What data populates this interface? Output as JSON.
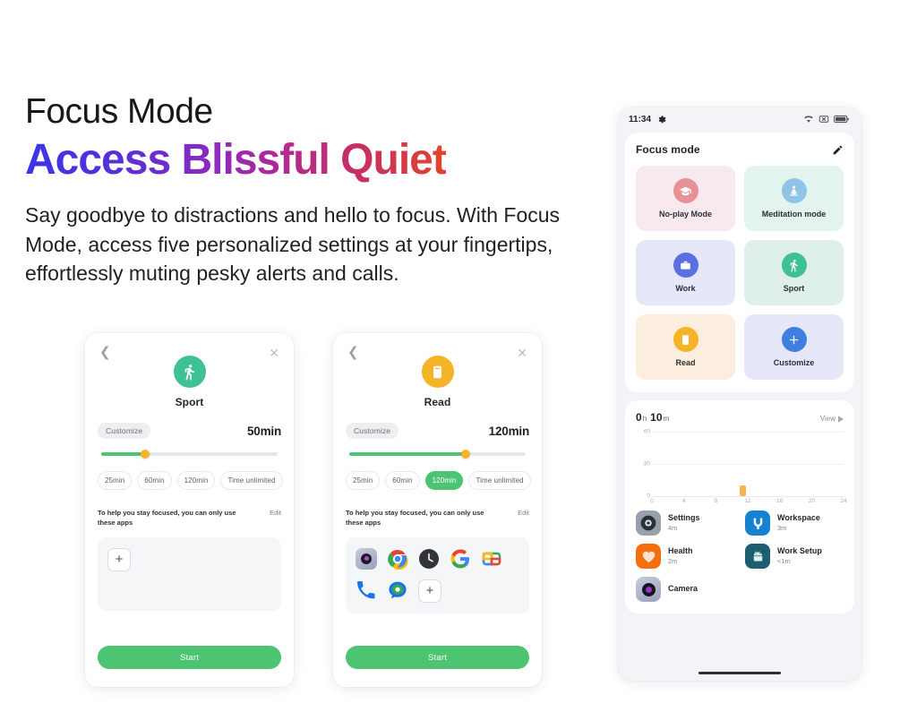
{
  "marketing": {
    "eyebrow": "Focus Mode",
    "headline": "Access Blissful Quiet",
    "body": "Say goodbye to distractions and hello to focus. With Focus Mode, access five personalized settings at your fingertips, effortlessly muting pesky alerts and calls."
  },
  "mock_sport": {
    "back_icon": "chevron-left-icon",
    "close_icon": "close-icon",
    "mode_name": "Sport",
    "mode_icon": "running-icon",
    "mode_color": "#3fc293",
    "customize_label": "Customize",
    "duration_value": "50min",
    "slider_percent": 25,
    "pills": [
      {
        "label": "25min",
        "selected": false
      },
      {
        "label": "60min",
        "selected": false
      },
      {
        "label": "120min",
        "selected": false
      },
      {
        "label": "Time unlimited",
        "selected": false
      }
    ],
    "note": "To help you stay focused, you can only use these apps",
    "edit_label": "Edit",
    "apps": [],
    "add_label": "+",
    "start_label": "Start"
  },
  "mock_read": {
    "back_icon": "chevron-left-icon",
    "close_icon": "close-icon",
    "mode_name": "Read",
    "mode_icon": "book-icon",
    "mode_color": "#f5b327",
    "customize_label": "Customize",
    "duration_value": "120min",
    "slider_percent": 66,
    "pills": [
      {
        "label": "25min",
        "selected": false
      },
      {
        "label": "60min",
        "selected": false
      },
      {
        "label": "120min",
        "selected": true
      },
      {
        "label": "Time unlimited",
        "selected": false
      }
    ],
    "note": "To help you stay focused, you can only use these apps",
    "edit_label": "Edit",
    "apps": [
      "camera-icon",
      "chrome-icon",
      "clock-icon",
      "google-icon",
      "photos-icon",
      "phone-icon",
      "messages-icon"
    ],
    "add_label": "+",
    "start_label": "Start"
  },
  "phone": {
    "statusbar": {
      "time": "11:34",
      "left_icon": "gear-icon",
      "right_icons": [
        "wifi-icon",
        "mute-box-icon",
        "battery-icon"
      ]
    },
    "panel": {
      "title": "Focus mode",
      "edit_icon": "pencil-icon",
      "modes": [
        {
          "label": "No-play Mode",
          "icon": "graduation-cap-icon",
          "bg": "#f7e9ed",
          "circle": "#e79194"
        },
        {
          "label": "Meditation mode",
          "icon": "meditation-icon",
          "bg": "#e3f4ef",
          "circle": "#8fc3e8"
        },
        {
          "label": "Work",
          "icon": "briefcase-icon",
          "bg": "#e6e7f9",
          "circle": "#5b6fe0"
        },
        {
          "label": "Sport",
          "icon": "running-icon",
          "bg": "#dff0ea",
          "circle": "#3fc293"
        },
        {
          "label": "Read",
          "icon": "book-icon",
          "bg": "#fbeede",
          "circle": "#f5b327"
        },
        {
          "label": "Customize",
          "icon": "plus-icon",
          "bg": "#e6e7f9",
          "circle": "#3f7fe0"
        }
      ]
    },
    "stats": {
      "hours": "0",
      "hours_unit": "h",
      "minutes": "10",
      "minutes_unit": "m",
      "view_label": "View",
      "view_icon": "chevron-right-icon"
    },
    "apps": [
      {
        "name": "Settings",
        "duration": "4m",
        "icon": "settings-icon"
      },
      {
        "name": "Workspace",
        "duration": "3m",
        "icon": "workspace-icon"
      },
      {
        "name": "Health",
        "duration": "2m",
        "icon": "health-icon"
      },
      {
        "name": "Work Setup",
        "duration": "<1m",
        "icon": "android-work-icon"
      },
      {
        "name": "Camera",
        "duration": "",
        "icon": "camera-icon"
      }
    ]
  },
  "chart_data": {
    "type": "bar",
    "title": "0 h 10 m",
    "x": [
      0,
      1,
      2,
      3,
      4,
      5,
      6,
      7,
      8,
      9,
      10,
      11,
      12,
      13,
      14,
      15,
      16,
      17,
      18,
      19,
      20,
      21,
      22,
      23
    ],
    "values": [
      0,
      0,
      0,
      0,
      0,
      0,
      0,
      0,
      0,
      0,
      0,
      10,
      0,
      0,
      0,
      0,
      0,
      0,
      0,
      0,
      0,
      0,
      0,
      0
    ],
    "xticks": [
      "0",
      "4",
      "8",
      "12",
      "16",
      "20",
      "24"
    ],
    "yticks": [
      "0",
      "30",
      "60"
    ],
    "xlim": [
      0,
      24
    ],
    "ylim": [
      0,
      60
    ],
    "xlabel": "",
    "ylabel": "",
    "bar_color": "#f5b64d",
    "grid": true,
    "legend": "none"
  }
}
